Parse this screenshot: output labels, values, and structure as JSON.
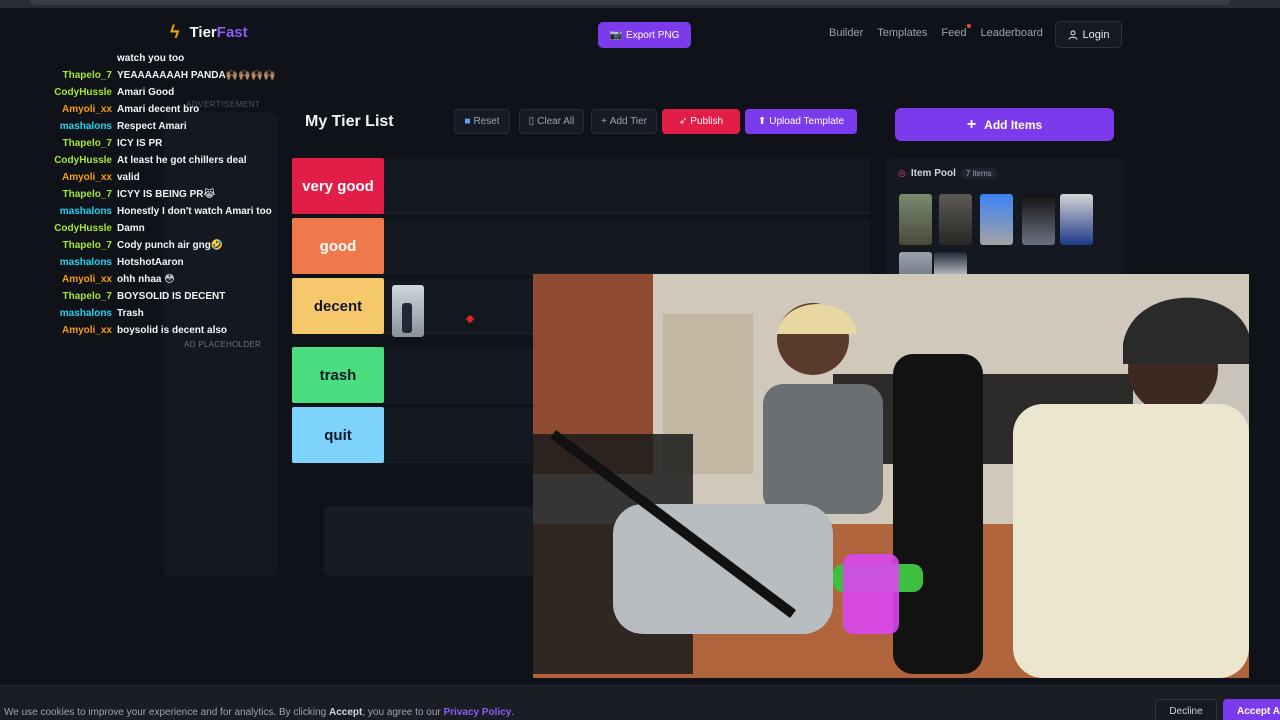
{
  "header": {
    "logo_icon": "bolt-icon",
    "logo_prefix": "Tier",
    "logo_suffix": "Fast",
    "export_icon": "camera-icon",
    "export_label": "Export PNG",
    "nav": [
      "Builder",
      "Templates",
      "Feed",
      "Leaderboard"
    ],
    "login_icon": "user-icon",
    "login_label": "Login"
  },
  "chat": [
    {
      "user": "",
      "msg": "watch you too",
      "color": "#a3e635"
    },
    {
      "user": "Thapelo_7",
      "msg": "YEAAAAAAAH PANDA🙌🏽🙌🏽🙌🏽🙌🏽",
      "color": "#a3e635"
    },
    {
      "user": "CodyHussle",
      "msg": "Amari Good",
      "color": "#a3e635"
    },
    {
      "user": "Amyoli_xx",
      "msg": "Amari decent bro",
      "color": "#f59e0b"
    },
    {
      "user": "mashalons",
      "msg": "Respect Amari",
      "color": "#22d3ee"
    },
    {
      "user": "Thapelo_7",
      "msg": "ICY IS PR",
      "color": "#a3e635"
    },
    {
      "user": "CodyHussle",
      "msg": "At least he got chillers deal",
      "color": "#a3e635"
    },
    {
      "user": "Amyoli_xx",
      "msg": "valid",
      "color": "#f59e0b"
    },
    {
      "user": "Thapelo_7",
      "msg": "ICYY IS BEING PR😹",
      "color": "#a3e635"
    },
    {
      "user": "mashalons",
      "msg": "Honestly I don't watch Amari too",
      "color": "#22d3ee"
    },
    {
      "user": "CodyHussle",
      "msg": "Damn",
      "color": "#a3e635"
    },
    {
      "user": "Thapelo_7",
      "msg": "Cody punch air gng🤣",
      "color": "#a3e635"
    },
    {
      "user": "mashalons",
      "msg": "HotshotAaron",
      "color": "#22d3ee"
    },
    {
      "user": "Amyoli_xx",
      "msg": "ohh nhaa 😳",
      "color": "#f59e0b"
    },
    {
      "user": "Thapelo_7",
      "msg": "BOYSOLID IS DECENT",
      "color": "#a3e635"
    },
    {
      "user": "mashalons",
      "msg": "Trash",
      "color": "#22d3ee"
    },
    {
      "user": "Amyoli_xx",
      "msg": "boysolid is decent also",
      "color": "#f59e0b"
    }
  ],
  "ads": {
    "label": "ADVERTISEMENT",
    "placeholder": "AD PLACEHOLDER"
  },
  "tierlist": {
    "title": "My Tier List",
    "buttons": {
      "reset": "Reset",
      "clear_all": "Clear All",
      "add_tier": "Add Tier",
      "publish": "Publish",
      "upload_template": "Upload Template"
    },
    "tiers": [
      {
        "label": "very good",
        "color": "#e11d48"
      },
      {
        "label": "good",
        "color": "#f0784a"
      },
      {
        "label": "decent",
        "color": "#f5c86b"
      },
      {
        "label": "trash",
        "color": "#4ade80"
      },
      {
        "label": "quit",
        "color": "#7dd3fc"
      }
    ]
  },
  "sidebar": {
    "add_items_label": "Add Items",
    "pool_title": "Item Pool",
    "pool_count": "7 items"
  },
  "cookie": {
    "text_before": "We use cookies to improve your experience and for analytics. By clicking ",
    "accept_word": "Accept",
    "text_after": ", you agree to our ",
    "privacy_link": "Privacy Policy",
    "period": ".",
    "decline_label": "Decline",
    "accept_label": "Accept A"
  }
}
